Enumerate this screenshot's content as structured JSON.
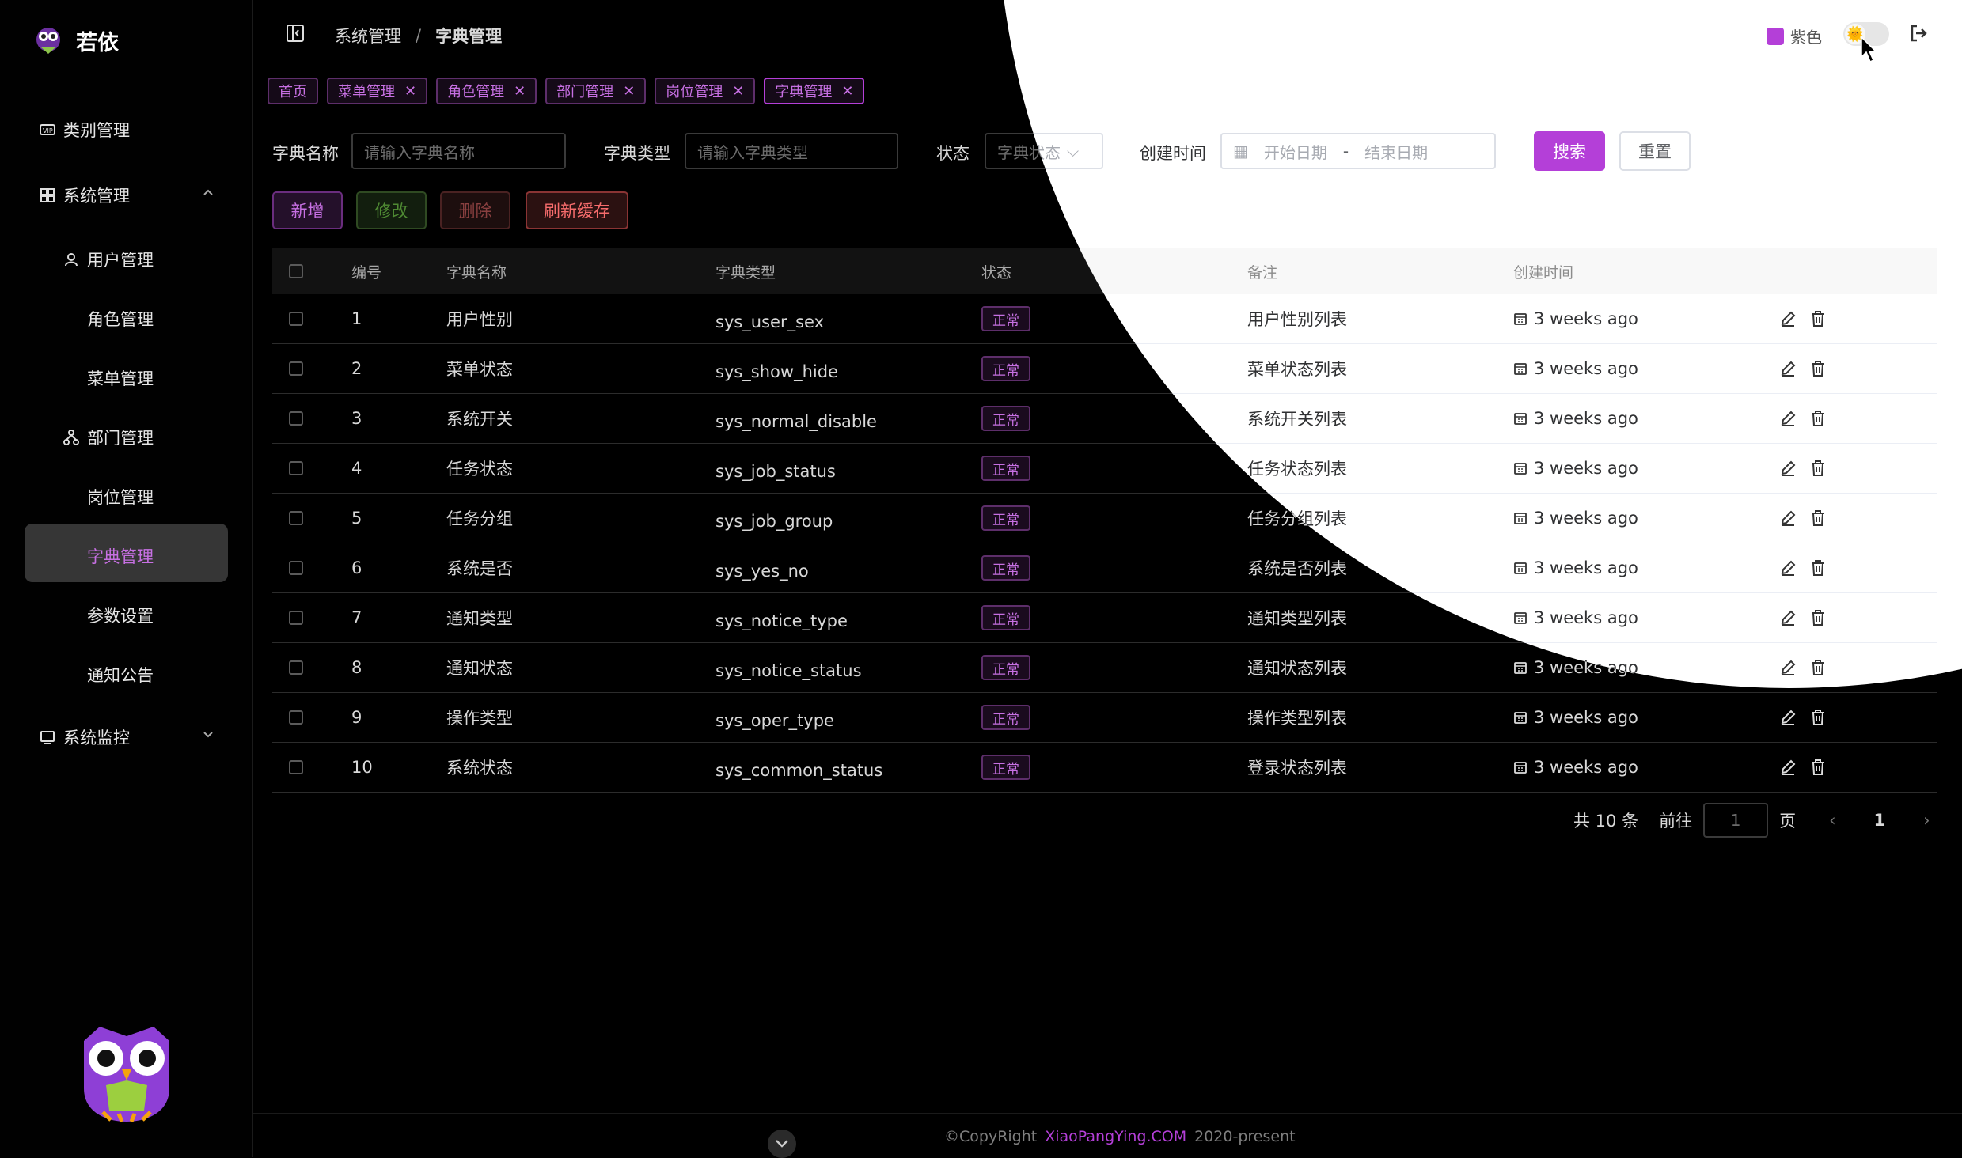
{
  "app": {
    "name": "若依"
  },
  "sidebar": {
    "items": [
      {
        "label": "类别管理",
        "icon": "vip-icon"
      },
      {
        "label": "系统管理",
        "icon": "grid-icon"
      },
      {
        "label": "用户管理",
        "icon": "user-icon"
      },
      {
        "label": "角色管理"
      },
      {
        "label": "菜单管理"
      },
      {
        "label": "部门管理",
        "icon": "tree-icon"
      },
      {
        "label": "岗位管理"
      },
      {
        "label": "字典管理"
      },
      {
        "label": "参数设置"
      },
      {
        "label": "通知公告"
      },
      {
        "label": "系统监控",
        "icon": "monitor-icon"
      }
    ]
  },
  "breadcrumb": {
    "parent": "系统管理",
    "separator": "/",
    "current": "字典管理"
  },
  "tabs": [
    "首页",
    "菜单管理",
    "角色管理",
    "部门管理",
    "岗位管理",
    "字典管理"
  ],
  "search": {
    "dict_name_label": "字典名称",
    "dict_name_placeholder": "请输入字典名称",
    "dict_type_label": "字典类型",
    "dict_type_placeholder": "请输入字典类型",
    "status_label": "状态",
    "status_placeholder": "字典状态",
    "created_label": "创建时间",
    "start_placeholder": "开始日期",
    "range_sep": "-",
    "end_placeholder": "结束日期",
    "search_btn": "搜索",
    "reset_btn": "重置"
  },
  "toolbar": {
    "add": "新增",
    "edit": "修改",
    "delete": "删除",
    "refresh_cache": "刷新缓存"
  },
  "table": {
    "headers": {
      "id": "编号",
      "name": "字典名称",
      "type": "字典类型",
      "status": "状态",
      "remark": "备注",
      "created": "创建时间"
    },
    "rows": [
      {
        "id": "1",
        "name": "用户性别",
        "type": "sys_user_sex",
        "status": "正常",
        "remark": "用户性别列表",
        "created": "3 weeks ago"
      },
      {
        "id": "2",
        "name": "菜单状态",
        "type": "sys_show_hide",
        "status": "正常",
        "remark": "菜单状态列表",
        "created": "3 weeks ago"
      },
      {
        "id": "3",
        "name": "系统开关",
        "type": "sys_normal_disable",
        "status": "正常",
        "remark": "系统开关列表",
        "created": "3 weeks ago"
      },
      {
        "id": "4",
        "name": "任务状态",
        "type": "sys_job_status",
        "status": "正常",
        "remark": "任务状态列表",
        "created": "3 weeks ago"
      },
      {
        "id": "5",
        "name": "任务分组",
        "type": "sys_job_group",
        "status": "正常",
        "remark": "任务分组列表",
        "created": "3 weeks ago"
      },
      {
        "id": "6",
        "name": "系统是否",
        "type": "sys_yes_no",
        "status": "正常",
        "remark": "系统是否列表",
        "created": "3 weeks ago"
      },
      {
        "id": "7",
        "name": "通知类型",
        "type": "sys_notice_type",
        "status": "正常",
        "remark": "通知类型列表",
        "created": "3 weeks ago"
      },
      {
        "id": "8",
        "name": "通知状态",
        "type": "sys_notice_status",
        "status": "正常",
        "remark": "通知状态列表",
        "created": "3 weeks ago"
      },
      {
        "id": "9",
        "name": "操作类型",
        "type": "sys_oper_type",
        "status": "正常",
        "remark": "操作类型列表",
        "created": "3 weeks ago"
      },
      {
        "id": "10",
        "name": "系统状态",
        "type": "sys_common_status",
        "status": "正常",
        "remark": "登录状态列表",
        "created": "3 weeks ago"
      }
    ]
  },
  "pager": {
    "total": "共 10 条",
    "goto": "前往",
    "page_input": "1",
    "page_unit": "页",
    "current": "1"
  },
  "topbar": {
    "theme_label": "紫色",
    "theme_color": "#b43fd8"
  },
  "footer": {
    "prefix": "©CopyRight",
    "brand": "XiaoPangYing.COM",
    "suffix": "2020-present"
  },
  "colors": {
    "accent": "#b43fd8",
    "danger": "#f56c6c",
    "success": "#67c23a"
  }
}
